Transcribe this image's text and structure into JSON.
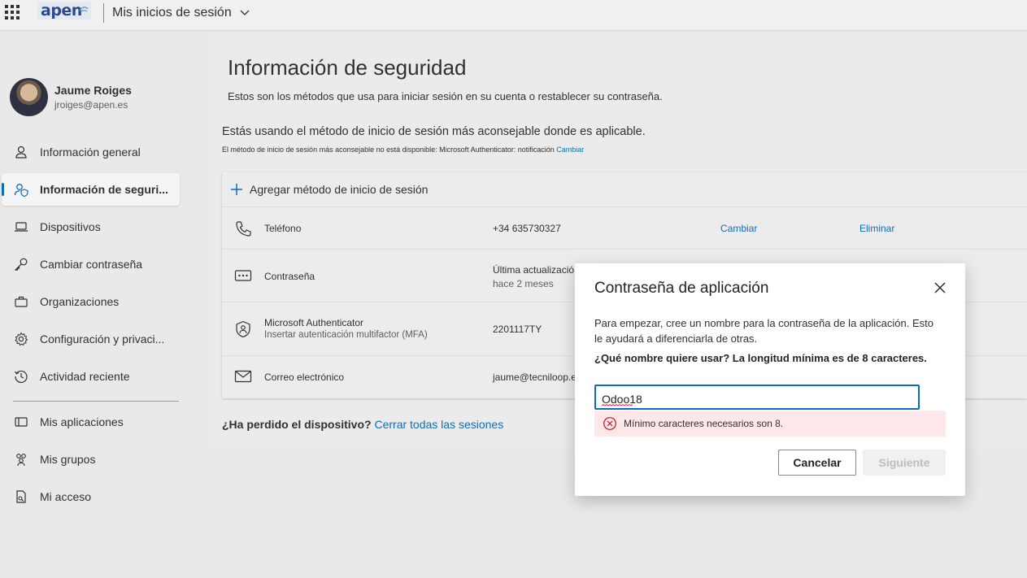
{
  "header": {
    "logo_text": "apen",
    "app_title": "Mis inicios de sesión"
  },
  "profile": {
    "name": "Jaume Roiges",
    "email": "jroiges@apen.es"
  },
  "nav": {
    "items": [
      {
        "label": "Información general",
        "icon": "person-icon"
      },
      {
        "label": "Información de seguri...",
        "icon": "security-info-icon",
        "active": true
      },
      {
        "label": "Dispositivos",
        "icon": "laptop-icon"
      },
      {
        "label": "Cambiar contraseña",
        "icon": "key-icon"
      },
      {
        "label": "Organizaciones",
        "icon": "briefcase-icon"
      },
      {
        "label": "Configuración y privaci...",
        "icon": "gear-icon"
      },
      {
        "label": "Actividad reciente",
        "icon": "history-icon"
      },
      {
        "label": "Mis aplicaciones",
        "icon": "apps-icon"
      },
      {
        "label": "Mis grupos",
        "icon": "people-icon"
      },
      {
        "label": "Mi acceso",
        "icon": "access-icon"
      }
    ]
  },
  "main": {
    "title": "Información de seguridad",
    "subtitle": "Estos son los métodos que usa para iniciar sesión en su cuenta o restablecer su contraseña.",
    "using_method": "Estás usando el método de inicio de sesión más aconsejable donde es aplicable.",
    "note": "El método de inicio de sesión más aconsejable no está disponible: Microsoft Authenticator: notificación",
    "note_link": "Cambiar",
    "add_method": "Agregar método de inicio de sesión",
    "methods": [
      {
        "name": "Teléfono",
        "value": "+34 635730327",
        "action1": "Cambiar",
        "action2": "Eliminar",
        "icon": "phone-icon"
      },
      {
        "name": "Contraseña",
        "value": "Última actualizació",
        "value2": "hace 2 meses",
        "icon": "password-icon"
      },
      {
        "name": "Microsoft Authenticator",
        "sub": "Insertar autenticación multifactor (MFA)",
        "value": "2201117TY",
        "icon": "authenticator-icon"
      },
      {
        "name": "Correo electrónico",
        "value": "jaume@tecniloop.e",
        "icon": "mail-icon"
      }
    ],
    "lost_device": "¿Ha perdido el dispositivo?",
    "lost_link": "Cerrar todas las sesiones"
  },
  "dialog": {
    "title": "Contraseña de aplicación",
    "description": "Para empezar, cree un nombre para la contraseña de la aplicación. Esto le ayudará a diferenciarla de otras.",
    "question": "¿Qué nombre quiere usar? La longitud mínima es de 8 caracteres.",
    "input_value": "Odoo18",
    "error": "Mínimo caracteres necesarios son 8.",
    "cancel_label": "Cancelar",
    "next_label": "Siguiente"
  },
  "colors": {
    "accent": "#0f6cbd",
    "error_bg": "#fde7e9",
    "error_icon": "#c50f1f"
  }
}
